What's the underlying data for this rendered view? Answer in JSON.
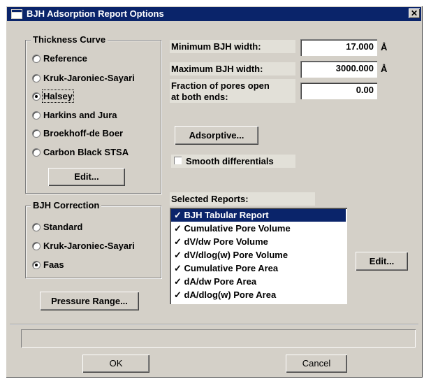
{
  "window": {
    "title": "BJH Adsorption Report Options",
    "close_label": "✕"
  },
  "thickness_curve": {
    "title": "Thickness Curve",
    "options": [
      {
        "label": "Reference",
        "selected": false
      },
      {
        "label": "Kruk-Jaroniec-Sayari",
        "selected": false
      },
      {
        "label": "Halsey",
        "selected": true
      },
      {
        "label": "Harkins and Jura",
        "selected": false
      },
      {
        "label": "Broekhoff-de Boer",
        "selected": false
      },
      {
        "label": "Carbon Black STSA",
        "selected": false
      }
    ],
    "edit_label": "Edit..."
  },
  "bjh_correction": {
    "title": "BJH Correction",
    "options": [
      {
        "label": "Standard",
        "selected": false
      },
      {
        "label": "Kruk-Jaroniec-Sayari",
        "selected": false
      },
      {
        "label": "Faas",
        "selected": true
      }
    ]
  },
  "pressure_range_label": "Pressure Range...",
  "fields": {
    "min_width_label": "Minimum BJH width:",
    "min_width_value": "17.000",
    "max_width_label": "Maximum BJH width:",
    "max_width_value": "3000.000",
    "unit": "Å",
    "fraction_label_line1": "Fraction of pores open",
    "fraction_label_line2": "at both ends:",
    "fraction_value": "0.00"
  },
  "adsorptive_label": "Adsorptive...",
  "smooth_label": "Smooth differentials",
  "smooth_checked": false,
  "selected_reports": {
    "label": "Selected Reports:",
    "items": [
      {
        "label": "✓ BJH Tabular Report",
        "selected": true
      },
      {
        "label": "✓ Cumulative Pore Volume",
        "selected": false
      },
      {
        "label": "✓ dV/dw Pore Volume",
        "selected": false
      },
      {
        "label": "✓ dV/dlog(w) Pore Volume",
        "selected": false
      },
      {
        "label": "✓ Cumulative Pore Area",
        "selected": false
      },
      {
        "label": "✓ dA/dw Pore Area",
        "selected": false
      },
      {
        "label": "✓ dA/dlog(w) Pore Area",
        "selected": false
      }
    ],
    "edit_label": "Edit..."
  },
  "footer": {
    "ok_label": "OK",
    "cancel_label": "Cancel"
  }
}
